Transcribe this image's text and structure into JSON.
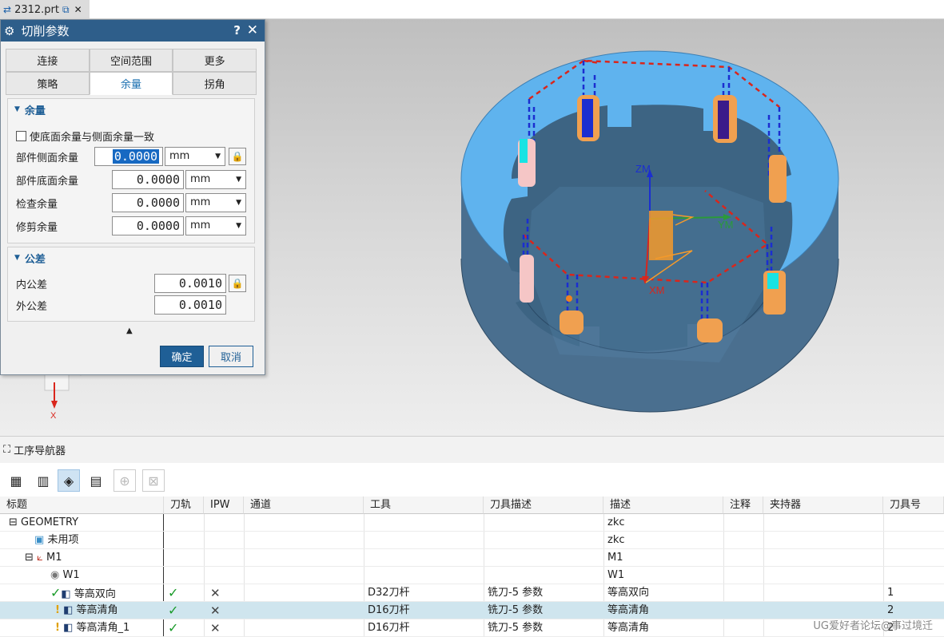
{
  "document_tab": {
    "title": "2312.prt"
  },
  "viewport": {
    "axis_labels": {
      "zm": "ZM",
      "ym": "YM",
      "xm": "XM",
      "x": "X"
    },
    "colors": {
      "part_top": "#5fb3ee",
      "part_side": "#4a6f8f",
      "toolpath": "#d9261c",
      "plunge": "#1b2ed0",
      "csys": "#f59a2a"
    }
  },
  "dialog": {
    "title": "切削参数",
    "help": "?",
    "close": "✕",
    "tabs_row1": [
      "连接",
      "空间范围",
      "更多"
    ],
    "tabs_row2": [
      "策略",
      "余量",
      "拐角"
    ],
    "active_tab": "余量",
    "stock_group": {
      "title": "余量",
      "checkbox_label": "使底面余量与侧面余量一致",
      "checkbox_checked": false,
      "fields": [
        {
          "label": "部件侧面余量",
          "value": "0.0000",
          "unit": "mm"
        },
        {
          "label": "部件底面余量",
          "value": "0.0000",
          "unit": "mm"
        },
        {
          "label": "检查余量",
          "value": "0.0000",
          "unit": "mm"
        },
        {
          "label": "修剪余量",
          "value": "0.0000",
          "unit": "mm"
        }
      ]
    },
    "tolerance_group": {
      "title": "公差",
      "fields": [
        {
          "label": "内公差",
          "value": "0.0010"
        },
        {
          "label": "外公差",
          "value": "0.0010"
        }
      ]
    },
    "ok_label": "确定",
    "cancel_label": "取消"
  },
  "navigator": {
    "title": "工序导航器",
    "columns": [
      "标题",
      "刀轨",
      "IPW",
      "通道",
      "工具",
      "刀具描述",
      "描述",
      "注释",
      "夹持器",
      "刀具号"
    ],
    "rows": [
      {
        "title": "GEOMETRY",
        "path": "",
        "ipw": "",
        "tool": "",
        "tool_desc": "",
        "desc": "zkc",
        "tool_no": ""
      },
      {
        "title": "未用项",
        "path": "",
        "ipw": "",
        "tool": "",
        "tool_desc": "",
        "desc": "zkc",
        "tool_no": ""
      },
      {
        "title": "M1",
        "path": "",
        "ipw": "",
        "tool": "",
        "tool_desc": "",
        "desc": "M1",
        "tool_no": ""
      },
      {
        "title": "W1",
        "path": "",
        "ipw": "",
        "tool": "",
        "tool_desc": "",
        "desc": "W1",
        "tool_no": ""
      },
      {
        "title": "等高双向",
        "path": "✓",
        "ipw": "✕",
        "tool": "D32刀杆",
        "tool_desc": "铣刀-5 参数",
        "desc": "等高双向",
        "tool_no": "1"
      },
      {
        "title": "等高清角",
        "path": "✓",
        "ipw": "✕",
        "tool": "D16刀杆",
        "tool_desc": "铣刀-5 参数",
        "desc": "等高清角",
        "tool_no": "2"
      },
      {
        "title": "等高清角_1",
        "path": "✓",
        "ipw": "✕",
        "tool": "D16刀杆",
        "tool_desc": "铣刀-5 参数",
        "desc": "等高清角",
        "tool_no": "2"
      }
    ],
    "selected_row": 5
  },
  "watermark": "UG爱好者论坛@事过境迁"
}
